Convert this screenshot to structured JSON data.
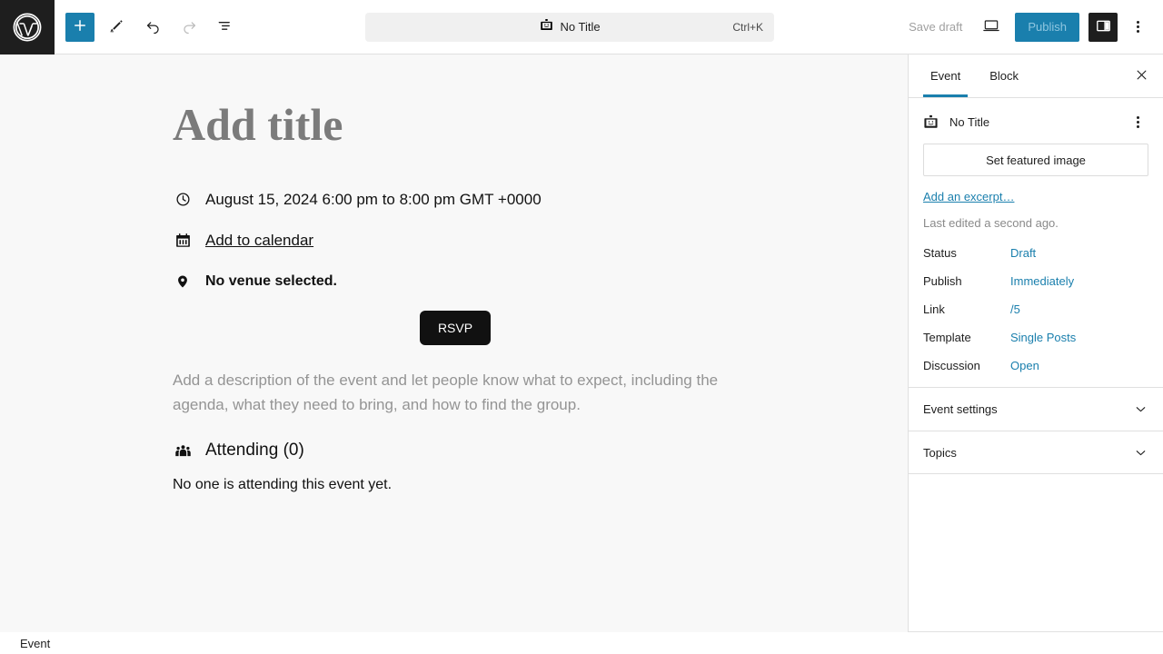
{
  "toolbar": {
    "logo_icon": "wordpress-logo-icon",
    "add_block_label": "+",
    "add_block_icon": "plus-icon",
    "tools_icon": "pencil-icon",
    "undo_icon": "undo-icon",
    "redo_icon": "redo-icon",
    "list_view_icon": "list-view-icon",
    "document_title": "No Title",
    "document_icon": "id-badge-icon",
    "command_shortcut": "Ctrl+K",
    "save_draft_label": "Save draft",
    "preview_icon": "desktop-preview-icon",
    "publish_label": "Publish",
    "sidebar_toggle_icon": "sidebar-panel-icon",
    "more_options_icon": "kebab-menu-icon"
  },
  "editor": {
    "title_placeholder": "Add title",
    "event": {
      "datetime_icon": "clock-icon",
      "datetime": "August 15, 2024 6:00 pm to 8:00 pm GMT +0000",
      "calendar_icon": "calendar-icon",
      "add_to_calendar_label": "Add to calendar",
      "venue_icon": "map-pin-icon",
      "venue_text": "No venue selected.",
      "rsvp_label": "RSVP",
      "description_placeholder": "Add a description of the event and let people know what to expect, including the agenda, what they need to bring, and how to find the group.",
      "attending_icon": "people-group-icon",
      "attending_label": "Attending (0)",
      "attending_empty": "No one is attending this event yet."
    }
  },
  "sidebar": {
    "tabs": [
      {
        "label": "Event",
        "active": true
      },
      {
        "label": "Block",
        "active": false
      }
    ],
    "close_icon": "close-icon",
    "document": {
      "icon": "id-badge-icon",
      "title": "No Title",
      "actions_icon": "kebab-menu-icon"
    },
    "featured_image_label": "Set featured image",
    "excerpt_link_label": "Add an excerpt…",
    "last_edited": "Last edited a second ago.",
    "meta": [
      {
        "label": "Status",
        "value": "Draft"
      },
      {
        "label": "Publish",
        "value": "Immediately"
      },
      {
        "label": "Link",
        "value": "/5"
      },
      {
        "label": "Template",
        "value": "Single Posts"
      },
      {
        "label": "Discussion",
        "value": "Open"
      }
    ],
    "panels": [
      {
        "title": "Event settings",
        "chevron_icon": "chevron-down-icon"
      },
      {
        "title": "Topics",
        "chevron_icon": "chevron-down-icon"
      }
    ]
  },
  "statusbar": {
    "block_type": "Event"
  },
  "colors": {
    "accent": "#1a7fad",
    "dark": "#1e1e1e",
    "canvas": "#f8f8f8",
    "link": "#1a7fad",
    "placeholder": "#7b7b7b"
  }
}
